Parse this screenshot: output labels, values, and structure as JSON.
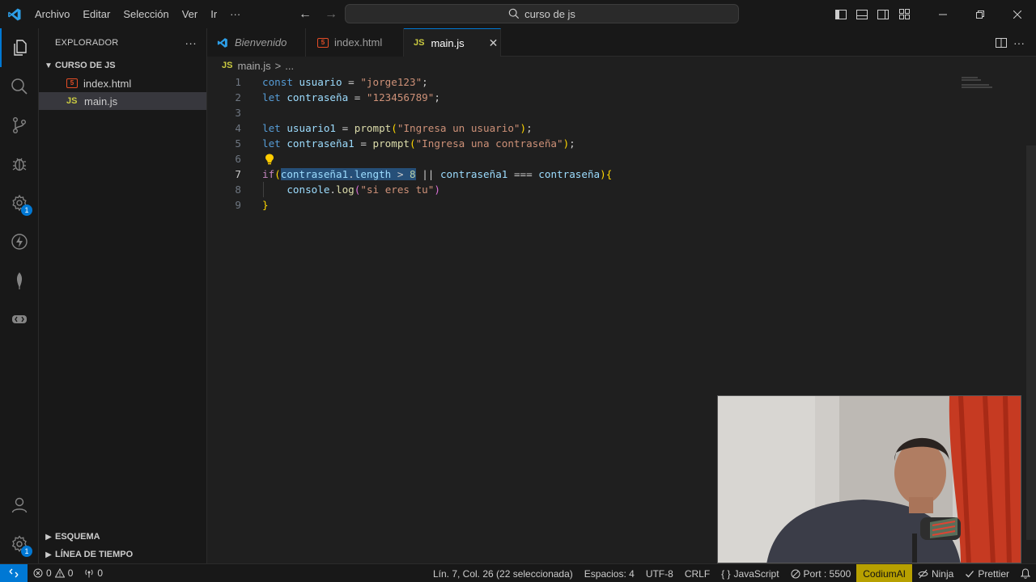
{
  "titlebar": {
    "menu": [
      "Archivo",
      "Editar",
      "Selección",
      "Ver",
      "Ir"
    ],
    "more": "···",
    "search_text": "curso de js"
  },
  "activitybar": {
    "extensions_badge": "1",
    "accounts_badge": "1"
  },
  "sidebar": {
    "title": "EXPLORADOR",
    "more": "···",
    "folder": "CURSO DE JS",
    "files": [
      {
        "name": "index.html",
        "type": "html"
      },
      {
        "name": "main.js",
        "type": "js"
      }
    ],
    "outline": "ESQUEMA",
    "timeline": "LÍNEA DE TIEMPO"
  },
  "tabs": [
    {
      "label": "Bienvenido"
    },
    {
      "label": "index.html"
    },
    {
      "label": "main.js"
    }
  ],
  "tab_js_glyph": "JS",
  "breadcrumbs": {
    "file": "main.js",
    "sep": ">",
    "rest": "..."
  },
  "editor": {
    "line_numbers": [
      "1",
      "2",
      "3",
      "4",
      "5",
      "6",
      "7",
      "8",
      "9"
    ],
    "current_line": 7
  },
  "statusbar": {
    "errors": "0",
    "warnings": "0",
    "ports": "0",
    "position": "Lín. 7, Col. 26 (22 seleccionada)",
    "spaces": "Espacios: 4",
    "encoding": "UTF-8",
    "eol": "CRLF",
    "braces": "{ }",
    "language": "JavaScript",
    "port": "Port : 5500",
    "codium": "CodiumAI",
    "ninja": "Ninja",
    "prettier": "Prettier"
  },
  "colors": {
    "accent": "#0078d4",
    "codium": "#b7a000",
    "selection": "#264f78"
  }
}
